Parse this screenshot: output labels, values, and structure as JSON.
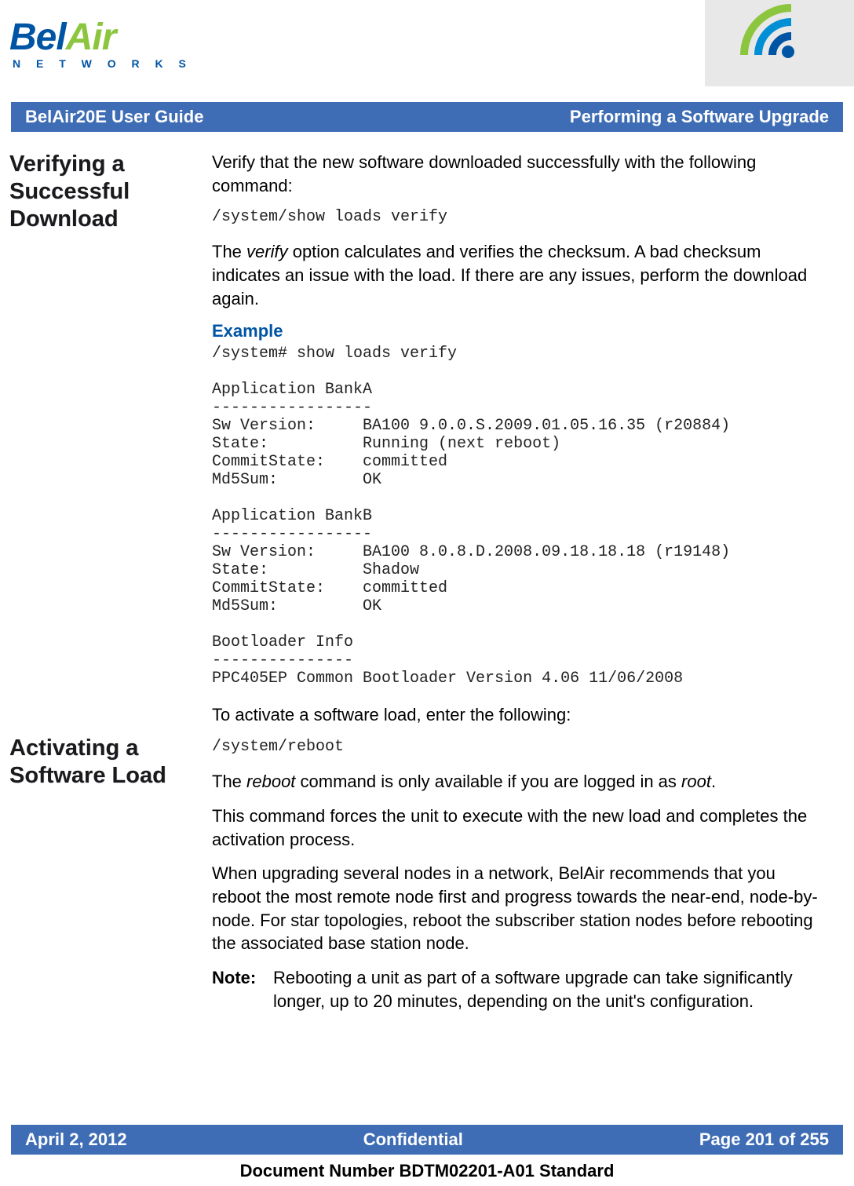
{
  "logo": {
    "bel": "Bel",
    "air": "Air",
    "sub": "N E T W O R K S"
  },
  "header": {
    "left": "BelAir20E User Guide",
    "right": "Performing a Software Upgrade"
  },
  "sections": {
    "verify": {
      "heading": "Verifying a Successful Download",
      "intro": "Verify that the new software downloaded successfully with the following command:",
      "cmd": "/system/show loads verify",
      "explain_prefix": "The ",
      "verify_kw": "verify",
      "explain_suffix": " option calculates and verifies the checksum. A bad checksum indicates an issue with the load. If there are any issues, perform the download again.",
      "example_label": "Example",
      "example": "/system# show loads verify\n\nApplication BankA\n-----------------\nSw Version:     BA100 9.0.0.S.2009.01.05.16.35 (r20884)\nState:          Running (next reboot)\nCommitState:    committed\nMd5Sum:         OK\n\nApplication BankB\n-----------------\nSw Version:     BA100 8.0.8.D.2008.09.18.18.18 (r19148)\nState:          Shadow\nCommitState:    committed\nMd5Sum:         OK\n\nBootloader Info\n---------------\nPPC405EP Common Bootloader Version 4.06 11/06/2008"
    },
    "activate": {
      "heading": "Activating a Software Load",
      "intro": "To activate a software load, enter the following:",
      "cmd": "/system/reboot",
      "p1_prefix": "The ",
      "reboot_kw": "reboot",
      "p1_mid": " command is only available if you are logged in as ",
      "root_kw": "root",
      "p1_suffix": ".",
      "p2": "This command forces the unit to execute with the new load and completes the activation process.",
      "p3": "When upgrading several nodes in a network, BelAir recommends that you reboot the most remote node first and progress towards the near-end, node-by-node. For star topologies, reboot the subscriber station nodes before rebooting the associated base station node.",
      "note_label": "Note:",
      "note_text": "Rebooting a unit as part of a software upgrade can take significantly longer, up to 20 minutes, depending on the unit's configuration."
    }
  },
  "footer": {
    "left": "April 2, 2012",
    "center": "Confidential",
    "right": "Page 201 of 255",
    "docnum": "Document Number BDTM02201-A01 Standard"
  }
}
